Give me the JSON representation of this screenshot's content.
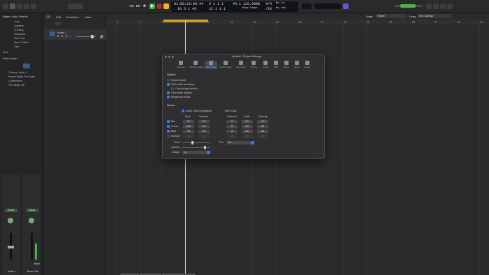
{
  "toolbar": {
    "position_time": "01:00:19:00.44",
    "position_bars": "9  1  1  1",
    "position_sub": "10  3  1  43",
    "position_bars2": "12  1  1  1",
    "tempo": "120.0000",
    "keep_tempo": "Keep Tempo",
    "sig_top": "4/4",
    "sig_bottom": "/16",
    "bpm_small": "44.1",
    "midi_in": "No In",
    "midi_out": "No Out",
    "accent": "#f0b429"
  },
  "inspector": {
    "region_header": "Region: Audio Defaults",
    "rows": [
      "Loop",
      "Quantize",
      "Q-Swing",
      "Transpose",
      "Fine Tune",
      "Flex & Follow",
      "Gain",
      "More"
    ],
    "track_header": "Track: Audio 1",
    "track_rows": [
      "Icon",
      "Channel: Audio 1",
      "Freeze Mode: Pre Fader",
      "Q-Reference",
      "Flex Mode: Off"
    ],
    "channel_left": "Audio 1",
    "channel_right": "Stereo Out",
    "read_left": "Read",
    "read_right": "Read",
    "bnce": "Bnce"
  },
  "tracks": {
    "menu": [
      "Edit",
      "Functions",
      "View"
    ],
    "track_name": "Audio 1",
    "track_buttons": [
      "M",
      "S",
      "R",
      "I"
    ]
  },
  "arrange": {
    "snap_label": "Snap:",
    "snap_value": "Smart",
    "drag_label": "Drag:",
    "drag_value": "No Overlap",
    "ruler": [
      "1",
      "3",
      "5",
      "7",
      "9",
      "11",
      "12",
      "13",
      "15",
      "17",
      "19",
      "21",
      "23",
      "25",
      "27",
      "29",
      "31"
    ]
  },
  "dialog": {
    "title": "Untitled - Project Settings",
    "tabs": [
      "General",
      "Synchronization",
      "Metronome",
      "Smart Tempo",
      "Recording",
      "Tuning",
      "Audio",
      "MIDI",
      "Score",
      "Movie",
      "Assets"
    ],
    "options_header": "Options",
    "options": [
      {
        "label": "Simple mode",
        "checked": false
      },
      {
        "label": "Click while recording",
        "checked": true
      },
      {
        "label": "Only during count-in",
        "checked": false
      },
      {
        "label": "Click while playing",
        "checked": true
      },
      {
        "label": "Polyphonic clicks",
        "checked": true
      }
    ],
    "source_header": "Source",
    "audio_click_label": "Audio Click (Klopfgeist)",
    "midi_click_label": "MIDI Click",
    "col_note": "Note",
    "col_velocity": "Velocity",
    "col_channel": "Channel",
    "rows": [
      {
        "label": "Bar",
        "checked": true,
        "note": "F5",
        "velocity": "127",
        "channel": "10",
        "midi_note": "C#1",
        "midi_velocity": "112"
      },
      {
        "label": "Group",
        "checked": true,
        "note": "D#5",
        "velocity": "119",
        "channel": "10",
        "midi_note": "C#1",
        "midi_velocity": "88"
      },
      {
        "label": "Beat",
        "checked": true,
        "note": "C5",
        "velocity": "112",
        "channel": "10",
        "midi_note": "C#1",
        "midi_velocity": "88"
      },
      {
        "label": "Division",
        "checked": false,
        "note": "C5",
        "velocity": "82",
        "channel": "10",
        "midi_note": "C#1",
        "midi_velocity": "88"
      }
    ],
    "tone_label": "Tone:",
    "volume_label": "Volume:",
    "output_label": "Output:",
    "output_value": "1-2",
    "port_label": "Port:",
    "port_value": "Off",
    "tone_level": 0.35,
    "volume_level": 0.8
  }
}
